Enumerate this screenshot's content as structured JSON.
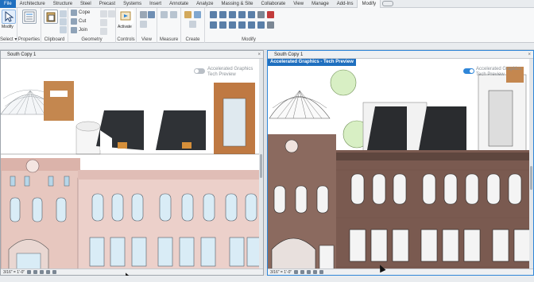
{
  "ribbon": {
    "tabs": [
      "File",
      "Architecture",
      "Structure",
      "Steel",
      "Precast",
      "Systems",
      "Insert",
      "Annotate",
      "Analyze",
      "Massing & Site",
      "Collaborate",
      "View",
      "Manage",
      "Add-Ins",
      "Modify"
    ],
    "active_tab": "Modify",
    "select_label": "Select ▾",
    "modify_label": "Modify",
    "panels": {
      "properties": "Properties",
      "clipboard": "Clipboard",
      "geometry": "Geometry",
      "controls": "Controls",
      "view": "View",
      "measure": "Measure",
      "create": "Create",
      "modify": "Modify"
    },
    "geometry_tools": [
      "Cope",
      "Cut",
      "Join"
    ],
    "activate_label": "Activate"
  },
  "left_view": {
    "title": "South Copy 1",
    "accel_line1": "Accelerated Graphics",
    "accel_line2": "Tech Preview",
    "toggle_on": false,
    "scale": "3/16\" = 1'-0\""
  },
  "right_view": {
    "title": "South Copy 1",
    "hover_label": "Accelerated Graphics - Tech Preview",
    "accel_line1": "Accelerated Graphics",
    "accel_line2": "Tech Preview",
    "toggle_on": true,
    "scale": "3/16\" = 1'-0\""
  },
  "colors": {
    "accent": "#1f6fbf",
    "facade_pink": "#e8c9c3",
    "brick_dark": "#6b4a40",
    "copper": "#b9713f"
  }
}
